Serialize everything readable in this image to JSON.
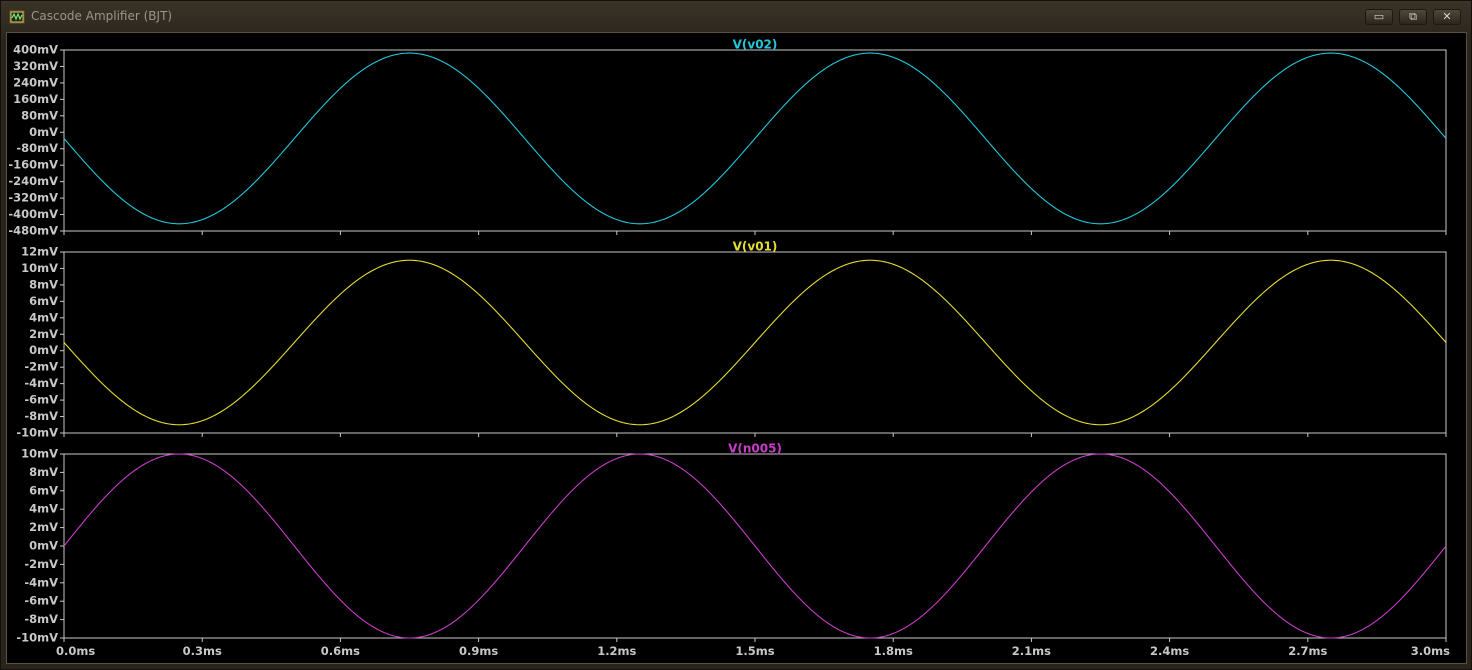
{
  "window": {
    "title": "Cascode Amplifier (BJT)",
    "app_icon": "waveform-viewer-icon",
    "buttons": [
      {
        "name": "minimize-button",
        "glyph": "▭"
      },
      {
        "name": "restore-button",
        "glyph": "⧉"
      },
      {
        "name": "close-button",
        "glyph": "✕"
      }
    ]
  },
  "colors": {
    "background": "#000000",
    "frame": "#c8c8c8",
    "v02": "#22c8dc",
    "v01": "#e6dc32",
    "n005": "#c83cc8"
  },
  "x_axis": {
    "ticks": [
      "0.0ms",
      "0.3ms",
      "0.6ms",
      "0.9ms",
      "1.2ms",
      "1.5ms",
      "1.8ms",
      "2.1ms",
      "2.4ms",
      "2.7ms",
      "3.0ms"
    ],
    "range_ms": [
      0,
      3.0
    ]
  },
  "chart_data": [
    {
      "type": "line",
      "title": "V(v02)",
      "color": "#22c8dc",
      "ylim_mV": [
        -480,
        400
      ],
      "y_ticks": [
        "400mV",
        "320mV",
        "240mV",
        "160mV",
        "80mV",
        "0mV",
        "-80mV",
        "-160mV",
        "-240mV",
        "-320mV",
        "-400mV",
        "-480mV"
      ],
      "y_tick_values_mV": [
        400,
        320,
        240,
        160,
        80,
        0,
        -80,
        -160,
        -240,
        -320,
        -400,
        -480
      ],
      "series": [
        {
          "frequency_hz": 1000,
          "amplitude_mV": 415,
          "offset_mV": -30,
          "phase": "inverted-sine",
          "x_ms": [
            0,
            3.0
          ]
        }
      ]
    },
    {
      "type": "line",
      "title": "V(v01)",
      "color": "#e6dc32",
      "ylim_mV": [
        -10,
        12
      ],
      "y_ticks": [
        "12mV",
        "10mV",
        "8mV",
        "6mV",
        "4mV",
        "2mV",
        "0mV",
        "-2mV",
        "-4mV",
        "-6mV",
        "-8mV",
        "-10mV"
      ],
      "y_tick_values_mV": [
        12,
        10,
        8,
        6,
        4,
        2,
        0,
        -2,
        -4,
        -6,
        -8,
        -10
      ],
      "series": [
        {
          "frequency_hz": 1000,
          "amplitude_mV": 10,
          "offset_mV": 1,
          "phase": "inverted-sine",
          "x_ms": [
            0,
            3.0
          ]
        }
      ]
    },
    {
      "type": "line",
      "title": "V(n005)",
      "color": "#c83cc8",
      "ylim_mV": [
        -10,
        10
      ],
      "y_ticks": [
        "10mV",
        "8mV",
        "6mV",
        "4mV",
        "2mV",
        "0mV",
        "-2mV",
        "-4mV",
        "-6mV",
        "-8mV",
        "-10mV"
      ],
      "y_tick_values_mV": [
        10,
        8,
        6,
        4,
        2,
        0,
        -2,
        -4,
        -6,
        -8,
        -10
      ],
      "series": [
        {
          "frequency_hz": 1000,
          "amplitude_mV": 10,
          "offset_mV": 0,
          "phase": "sine",
          "x_ms": [
            0,
            3.0
          ]
        }
      ]
    }
  ]
}
